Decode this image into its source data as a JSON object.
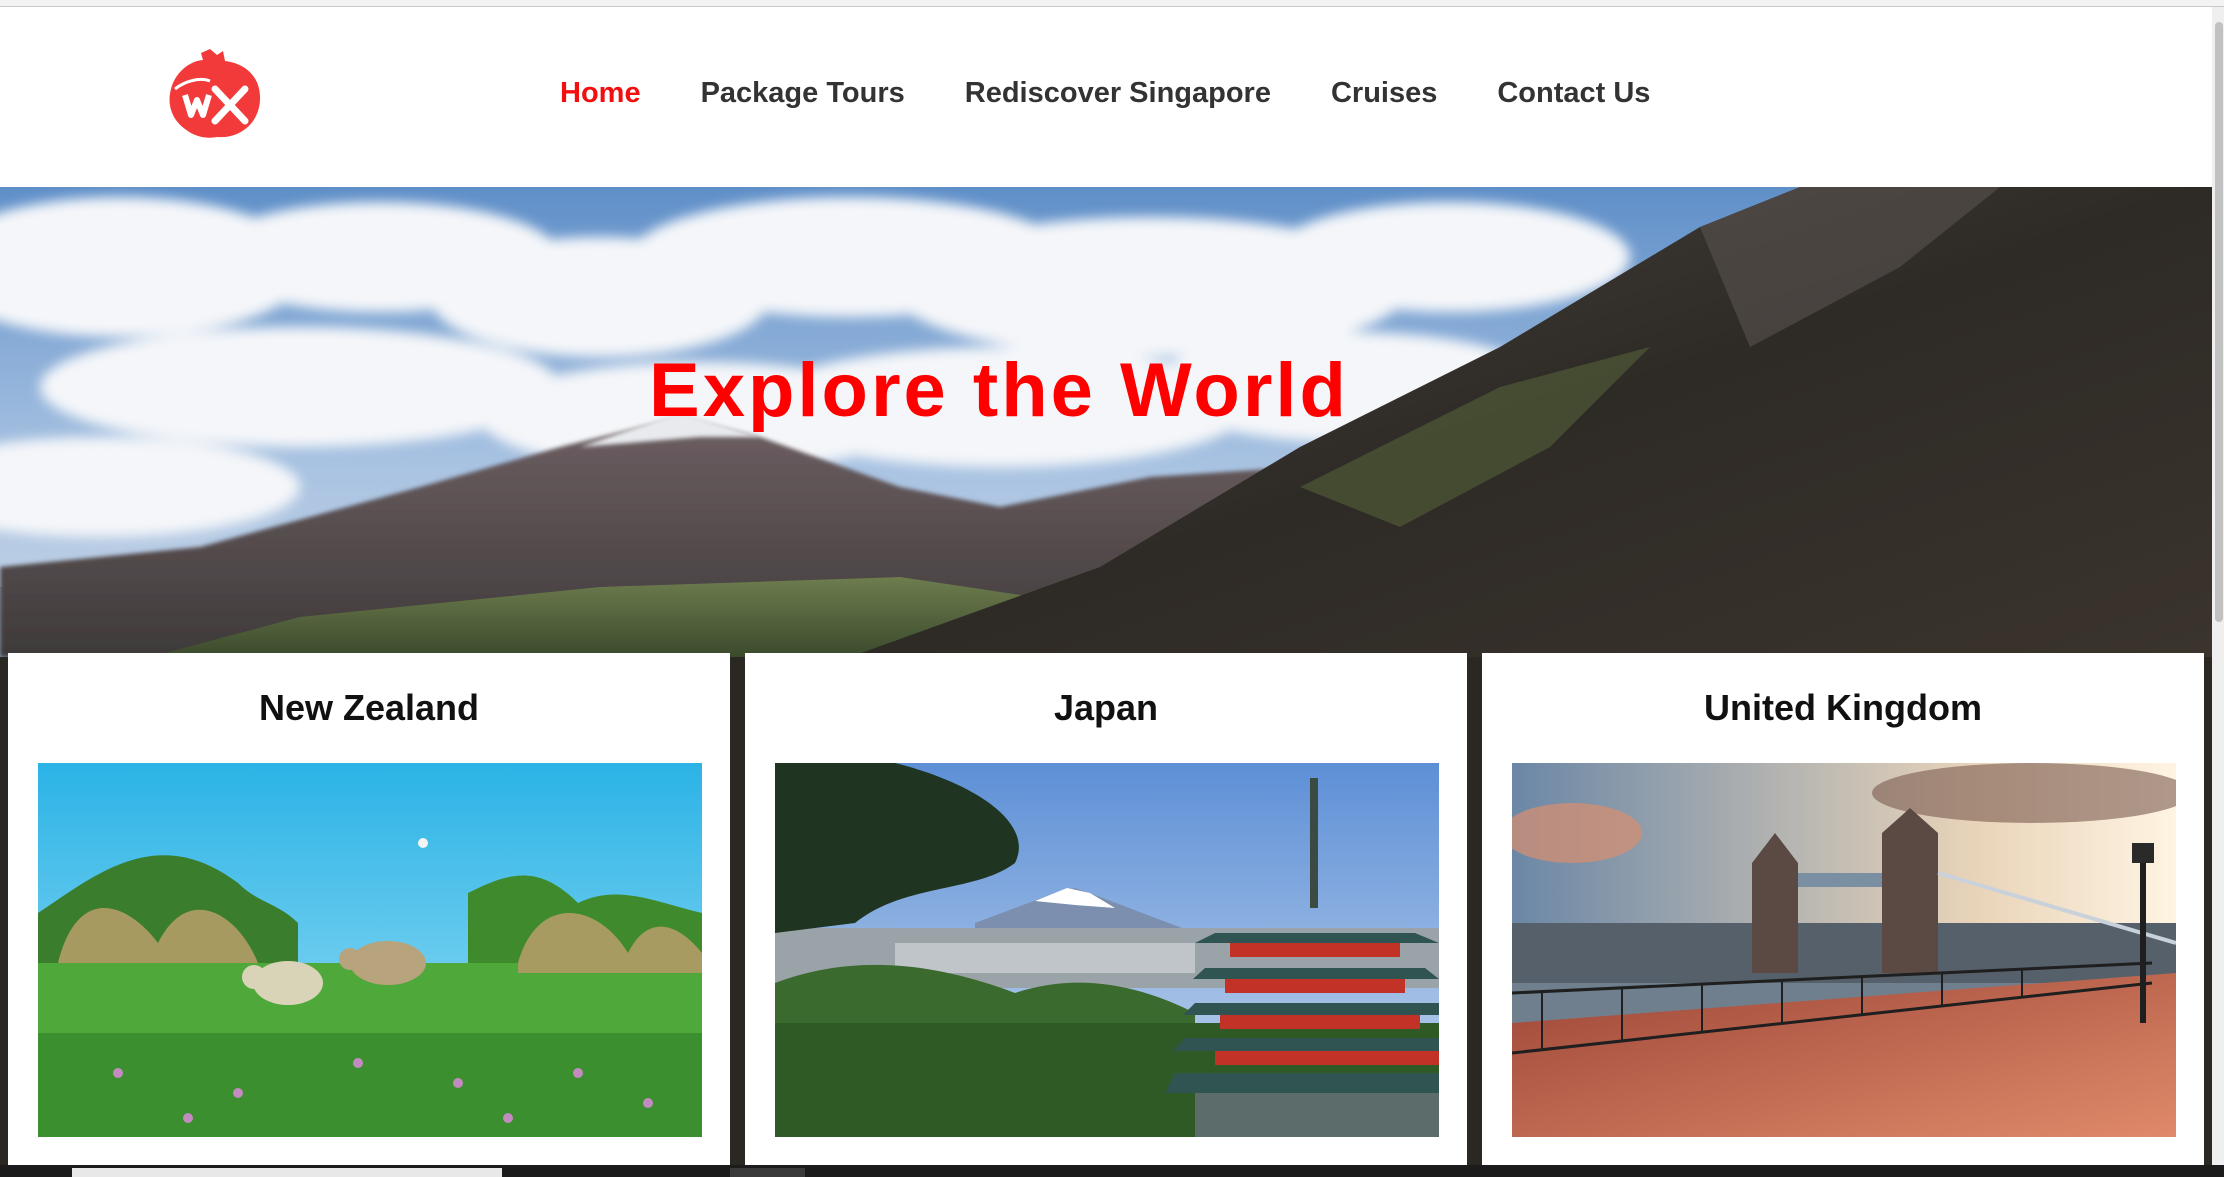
{
  "nav": {
    "items": [
      {
        "label": "Home",
        "active": true
      },
      {
        "label": "Package Tours",
        "active": false
      },
      {
        "label": "Rediscover Singapore",
        "active": false
      },
      {
        "label": "Cruises",
        "active": false
      },
      {
        "label": "Contact Us",
        "active": false
      }
    ]
  },
  "logo": {
    "text": "WX",
    "color": "#f23a3a"
  },
  "hero": {
    "title": "Explore the World",
    "title_color": "#ff0000"
  },
  "cards": [
    {
      "title": "New Zealand"
    },
    {
      "title": "Japan"
    },
    {
      "title": "United Kingdom"
    }
  ],
  "colors": {
    "accent": "#f20f0f",
    "nav_text": "#333333"
  }
}
